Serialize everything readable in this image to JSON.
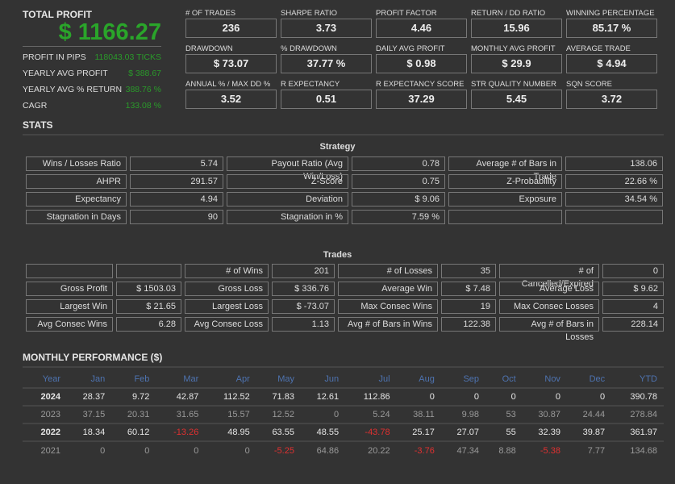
{
  "total_profit": {
    "label": "TOTAL PROFIT",
    "value": "$ 1166.27"
  },
  "left_stats": [
    {
      "label": "PROFIT IN PIPS",
      "value": "118043.03 TICKS"
    },
    {
      "label": "YEARLY AVG PROFIT",
      "value": "$ 388.67"
    },
    {
      "label": "YEARLY AVG % RETURN",
      "value": "388.76 %"
    },
    {
      "label": "CAGR",
      "value": "133.08 %"
    }
  ],
  "metrics": [
    {
      "label": "# OF TRADES",
      "value": "236"
    },
    {
      "label": "SHARPE RATIO",
      "value": "3.73"
    },
    {
      "label": "PROFIT FACTOR",
      "value": "4.46"
    },
    {
      "label": "RETURN / DD RATIO",
      "value": "15.96"
    },
    {
      "label": "WINNING PERCENTAGE",
      "value": "85.17 %"
    },
    {
      "label": "DRAWDOWN",
      "value": "$ 73.07"
    },
    {
      "label": "% DRAWDOWN",
      "value": "37.77 %"
    },
    {
      "label": "DAILY AVG PROFIT",
      "value": "$ 0.98"
    },
    {
      "label": "MONTHLY AVG PROFIT",
      "value": "$ 29.9"
    },
    {
      "label": "AVERAGE TRADE",
      "value": "$ 4.94"
    },
    {
      "label": "ANNUAL % / MAX DD %",
      "value": "3.52"
    },
    {
      "label": "R EXPECTANCY",
      "value": "0.51"
    },
    {
      "label": "R EXPECTANCY SCORE",
      "value": "37.29"
    },
    {
      "label": "STR QUALITY NUMBER",
      "value": "5.45"
    },
    {
      "label": "SQN SCORE",
      "value": "3.72"
    }
  ],
  "stats": {
    "title": "STATS",
    "strategy": {
      "title": "Strategy",
      "rows": [
        [
          "Wins / Losses Ratio",
          "5.74",
          "Payout Ratio (Avg Win/Loss)",
          "0.78",
          "Average # of Bars in Trade",
          "138.06"
        ],
        [
          "AHPR",
          "291.57",
          "Z-Score",
          "0.75",
          "Z-Probability",
          "22.66 %"
        ],
        [
          "Expectancy",
          "4.94",
          "Deviation",
          "$ 9.06",
          "Exposure",
          "34.54 %"
        ],
        [
          "Stagnation in Days",
          "90",
          "Stagnation in %",
          "7.59 %",
          "",
          ""
        ]
      ]
    },
    "trades": {
      "title": "Trades",
      "rows": [
        [
          "",
          "",
          "# of Wins",
          "201",
          "# of Losses",
          "35",
          "# of Cancelled/Expired",
          "0"
        ],
        [
          "Gross Profit",
          "$ 1503.03",
          "Gross Loss",
          "$ 336.76",
          "Average Win",
          "$ 7.48",
          "Average Loss",
          "$ 9.62"
        ],
        [
          "Largest Win",
          "$ 21.65",
          "Largest Loss",
          "$ -73.07",
          "Max Consec Wins",
          "19",
          "Max Consec Losses",
          "4"
        ],
        [
          "Avg Consec Wins",
          "6.28",
          "Avg Consec Loss",
          "1.13",
          "Avg # of Bars in Wins",
          "122.38",
          "Avg # of Bars in Losses",
          "228.14"
        ]
      ]
    }
  },
  "monthly": {
    "title": "MONTHLY PERFORMANCE ($)",
    "headers": [
      "Year",
      "Jan",
      "Feb",
      "Mar",
      "Apr",
      "May",
      "Jun",
      "Jul",
      "Aug",
      "Sep",
      "Oct",
      "Nov",
      "Dec",
      "YTD"
    ],
    "rows": [
      [
        "2024",
        "28.37",
        "9.72",
        "42.87",
        "112.52",
        "71.83",
        "12.61",
        "112.86",
        "0",
        "0",
        "0",
        "0",
        "0",
        "390.78"
      ],
      [
        "2023",
        "37.15",
        "20.31",
        "31.65",
        "15.57",
        "12.52",
        "0",
        "5.24",
        "38.11",
        "9.98",
        "53",
        "30.87",
        "24.44",
        "278.84"
      ],
      [
        "2022",
        "18.34",
        "60.12",
        "-13.26",
        "48.95",
        "63.55",
        "48.55",
        "-43.78",
        "25.17",
        "27.07",
        "55",
        "32.39",
        "39.87",
        "361.97"
      ],
      [
        "2021",
        "0",
        "0",
        "0",
        "0",
        "-5.25",
        "64.86",
        "20.22",
        "-3.76",
        "47.34",
        "8.88",
        "-5.38",
        "7.77",
        "134.68"
      ]
    ]
  },
  "colors": {
    "background": "#333333",
    "profit_green": "#2aa52a",
    "negative_red": "#e03030",
    "header_blue": "#4e73b0"
  }
}
